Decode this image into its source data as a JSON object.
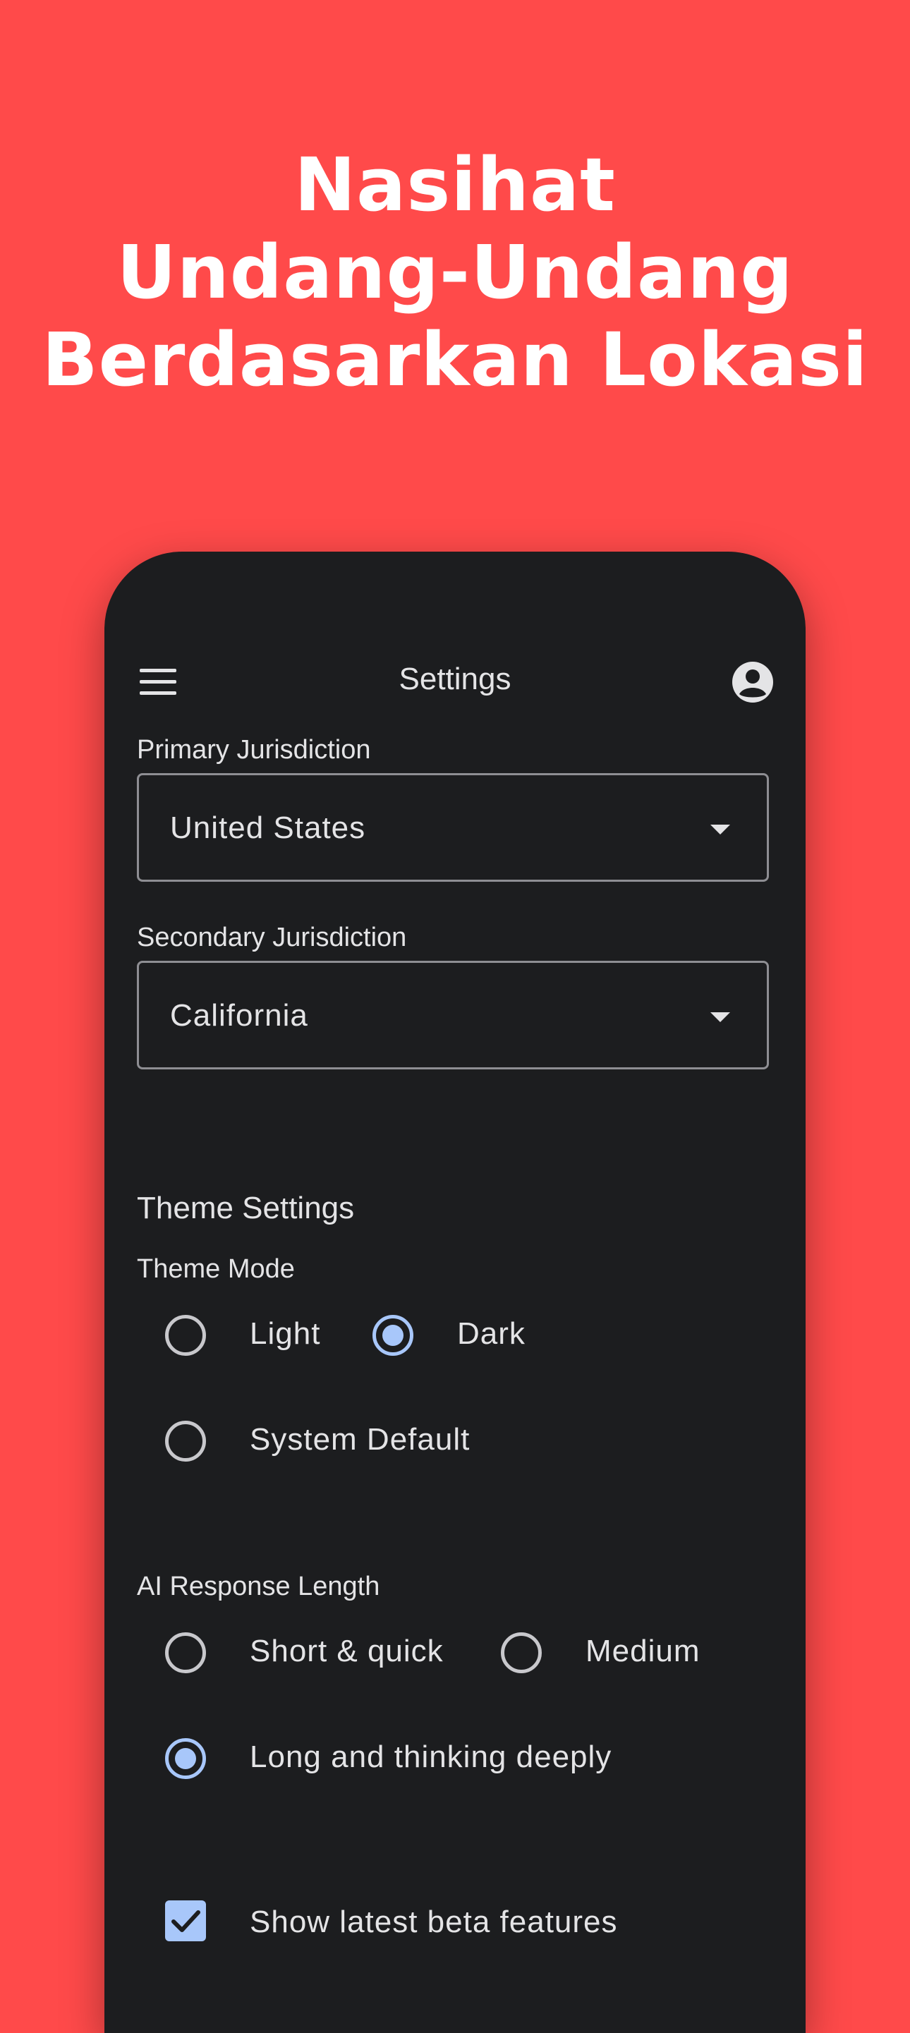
{
  "headline": {
    "line1": "Nasihat",
    "line2": "Undang-Undang",
    "line3": "Berdasarkan Lokasi"
  },
  "appbar": {
    "title": "Settings",
    "menu_icon": "menu-icon",
    "account_icon": "account-circle-icon"
  },
  "primary_jurisdiction": {
    "label": "Primary Jurisdiction",
    "value": "United States"
  },
  "secondary_jurisdiction": {
    "label": "Secondary Jurisdiction",
    "value": "California"
  },
  "theme_settings": {
    "title": "Theme Settings",
    "mode_label": "Theme Mode",
    "options": [
      "Light",
      "Dark",
      "System Default"
    ],
    "selected": "Dark"
  },
  "ai_response": {
    "label": "AI Response Length",
    "options": [
      "Short & quick",
      "Medium",
      "Long and thinking deeply"
    ],
    "selected": "Long and thinking deeply"
  },
  "beta": {
    "label": "Show latest beta features",
    "checked": true
  },
  "colors": {
    "background": "#FF4A4A",
    "surface": "#1C1D1F",
    "accent": "#A8C7FA",
    "text": "#E4E4E6"
  }
}
